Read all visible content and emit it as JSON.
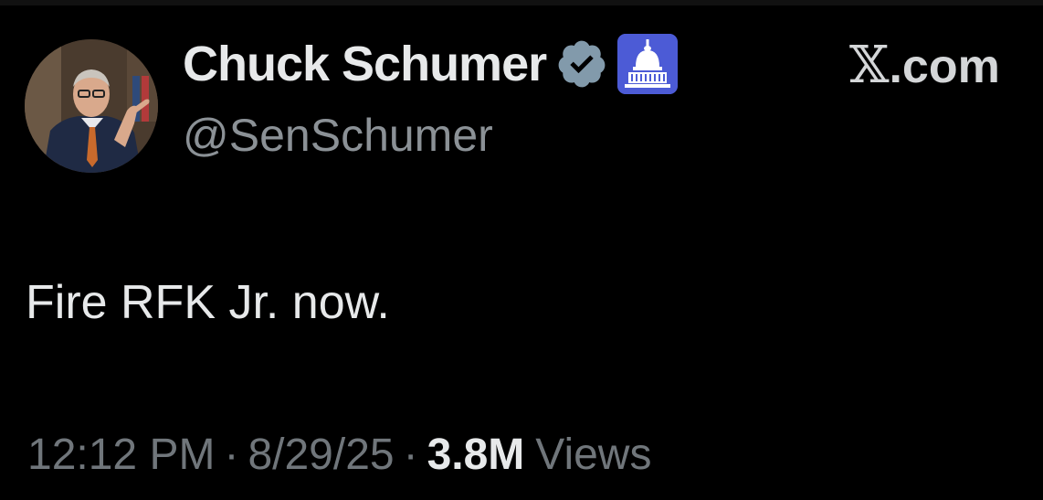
{
  "author": {
    "display_name": "Chuck Schumer",
    "handle": "@SenSchumer",
    "verified_icon": "verified-badge-icon",
    "affiliation_icon": "capitol-dome-icon"
  },
  "source": {
    "label": ".com",
    "logo": "𝕏"
  },
  "tweet": {
    "text": "Fire RFK Jr. now."
  },
  "meta": {
    "time": "12:12 PM",
    "separator": "·",
    "date": "8/29/25",
    "views_count": "3.8M",
    "views_label": "Views"
  },
  "colors": {
    "background": "#000000",
    "primary_text": "#e7e9ea",
    "secondary_text": "#70767b",
    "verified_badge": "#829aab",
    "affiliate_badge": "#4c5bd6"
  }
}
